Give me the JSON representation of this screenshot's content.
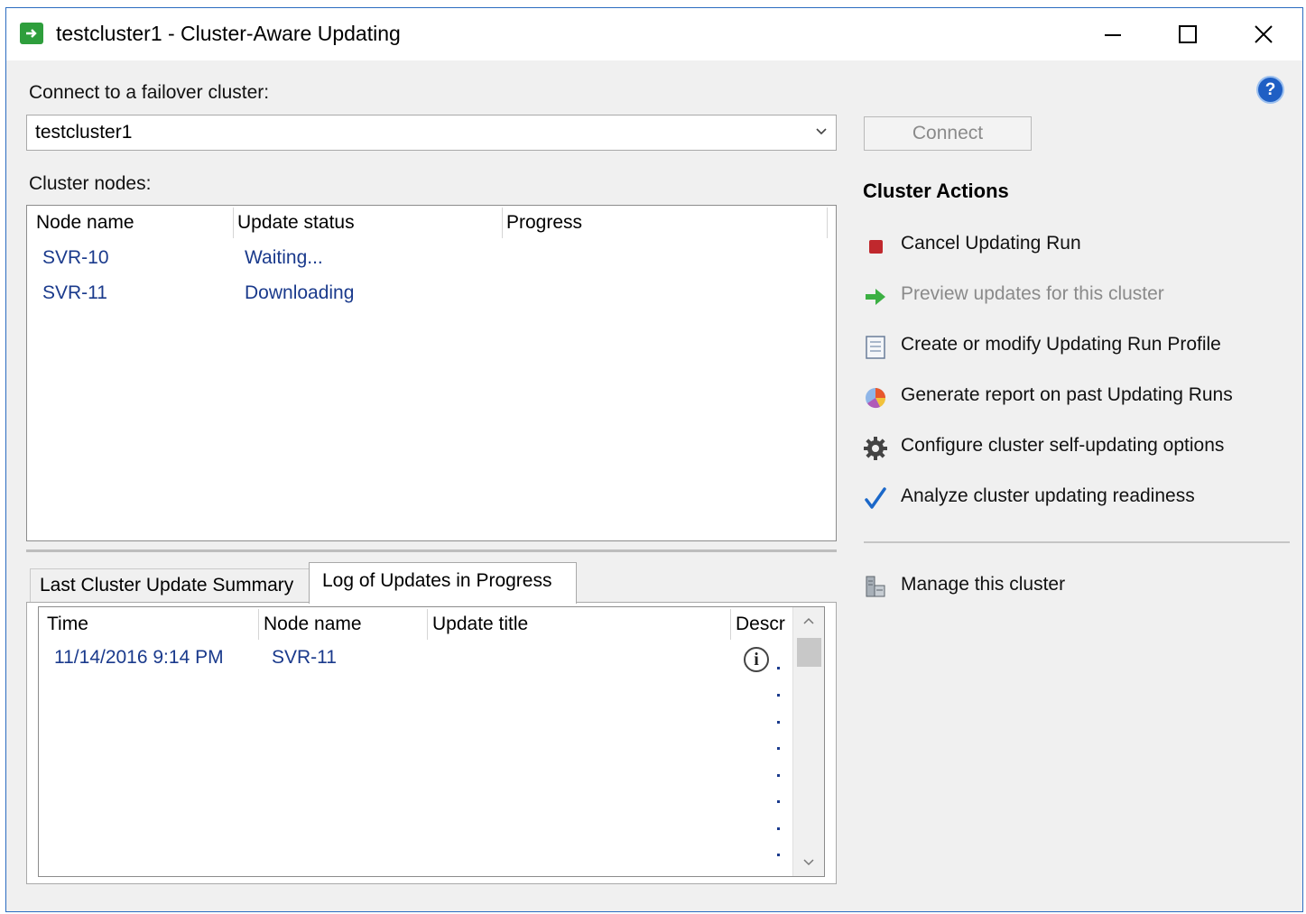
{
  "window": {
    "title": "testcluster1 - Cluster-Aware Updating",
    "controls": {
      "minimize": "minimize-icon",
      "maximize": "maximize-icon",
      "close": "close-icon"
    },
    "help_icon": "help-icon"
  },
  "connect": {
    "label": "Connect to a failover cluster:",
    "cluster_value": "testcluster1",
    "button_label": "Connect"
  },
  "nodes": {
    "label": "Cluster nodes:",
    "columns": [
      "Node name",
      "Update status",
      "Progress"
    ],
    "rows": [
      {
        "node": "SVR-10",
        "status": "Waiting...",
        "progress": ""
      },
      {
        "node": "SVR-11",
        "status": "Downloading",
        "progress": ""
      }
    ]
  },
  "tabs": [
    {
      "label": "Last Cluster Update Summary",
      "active": false
    },
    {
      "label": "Log of Updates in Progress",
      "active": true
    }
  ],
  "log": {
    "columns": [
      "Time",
      "Node name",
      "Update title",
      "Descr"
    ],
    "rows": [
      {
        "time": "11/14/2016 9:14 PM",
        "node": "SVR-11",
        "title": "",
        "descr_icon": "info-icon"
      }
    ]
  },
  "actions": {
    "title": "Cluster Actions",
    "items": [
      {
        "label": "Cancel Updating Run",
        "icon": "stop-icon",
        "enabled": true
      },
      {
        "label": "Preview updates for this cluster",
        "icon": "arrow-right-icon",
        "enabled": false
      },
      {
        "label": "Create or modify Updating Run Profile",
        "icon": "document-icon",
        "enabled": true
      },
      {
        "label": "Generate report on past Updating Runs",
        "icon": "report-chart-icon",
        "enabled": true
      },
      {
        "label": "Configure cluster self-updating options",
        "icon": "gear-icon",
        "enabled": true
      },
      {
        "label": "Analyze cluster updating readiness",
        "icon": "checkmark-icon",
        "enabled": true
      }
    ],
    "manage": {
      "label": "Manage this cluster",
      "icon": "server-manager-icon",
      "enabled": true
    }
  },
  "colors": {
    "link_blue": "#1a3a8c",
    "stop_red": "#c0282d",
    "arrow_green": "#3cb043",
    "check_blue": "#1b68c9",
    "window_border": "#2b6cc0"
  }
}
